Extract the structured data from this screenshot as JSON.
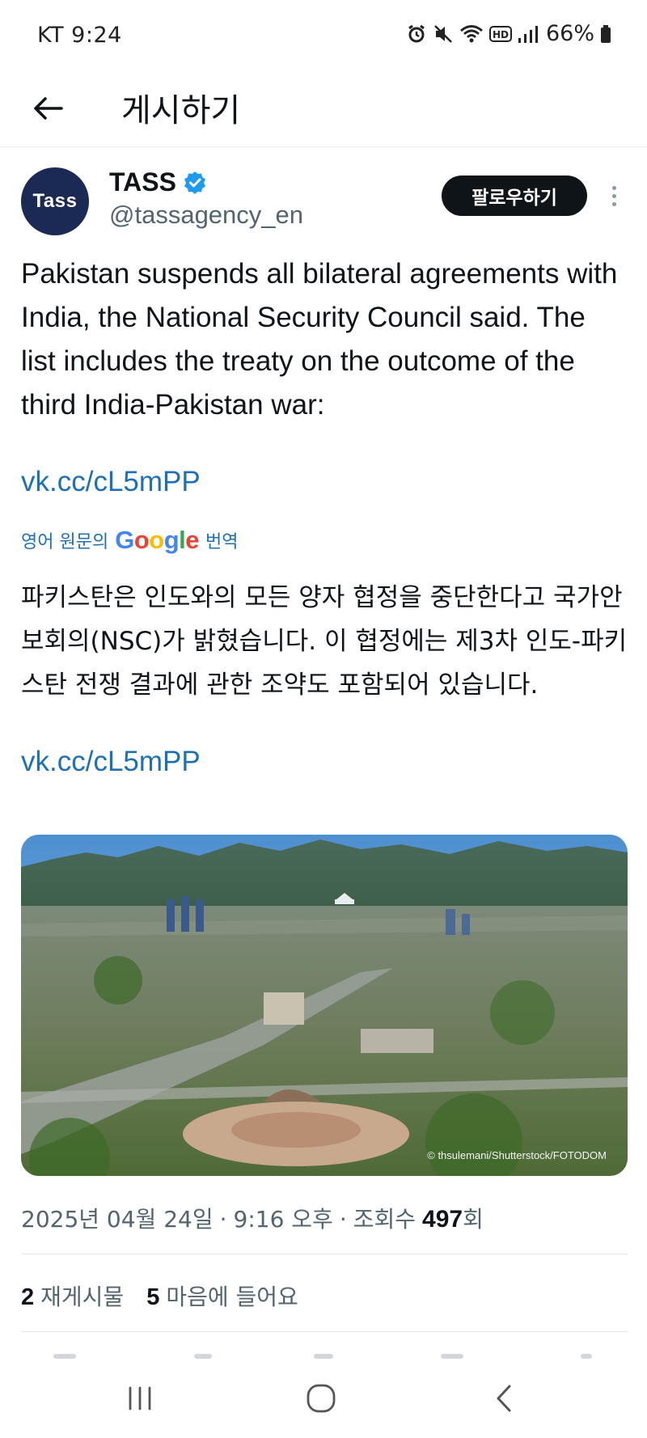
{
  "status_bar": {
    "carrier_time": "KT 9:24",
    "battery": "66%",
    "icons": [
      "alarm-icon",
      "mute-icon",
      "wifi-icon",
      "hd-icon",
      "signal-icon",
      "battery-icon"
    ]
  },
  "header": {
    "back_icon": "back-arrow-icon",
    "title": "게시하기"
  },
  "author": {
    "avatar_text": "Tass",
    "name": "TASS",
    "verified_icon": "verified-badge-icon",
    "handle": "@tassagency_en",
    "follow_label": "팔로우하기",
    "more_icon": "more-vertical-icon"
  },
  "tweet": {
    "text": "Pakistan suspends all bilateral agreements with India, the National Security Council said. The list includes the treaty on the outcome of the third India-Pakistan war:",
    "link": "vk.cc/cL5mPP",
    "translate_prefix": "영어 원문의",
    "translate_brand": "Google",
    "translate_suffix": "번역",
    "translated_text": "파키스탄은 인도와의 모든 양자 협정을 중단한다고 국가안보회의(NSC)가 밝혔습니다. 이 협정에는 제3차 인도-파키스탄 전쟁 결과에 관한 조약도 포함되어 있습니다.",
    "translated_link": "vk.cc/cL5mPP",
    "photo_credit": "© thsulemani/Shutterstock/FOTODOM"
  },
  "meta": {
    "date": "2025년 04월 24일",
    "separator": "·",
    "time": "9:16 오후",
    "views_label": "조회수",
    "views_count": "497",
    "views_suffix": "회"
  },
  "stats": {
    "reposts_count": "2",
    "reposts_label": "재게시물",
    "likes_count": "5",
    "likes_label": "마음에 들어요"
  },
  "nav": {
    "recents_icon": "recents-icon",
    "home_icon": "home-icon",
    "back_icon": "nav-back-icon"
  },
  "colors": {
    "link": "#1d6fb8",
    "text": "#0f1419",
    "secondary": "#536471",
    "avatar_bg": "#1b2a55",
    "verified": "#1d9bf0"
  }
}
